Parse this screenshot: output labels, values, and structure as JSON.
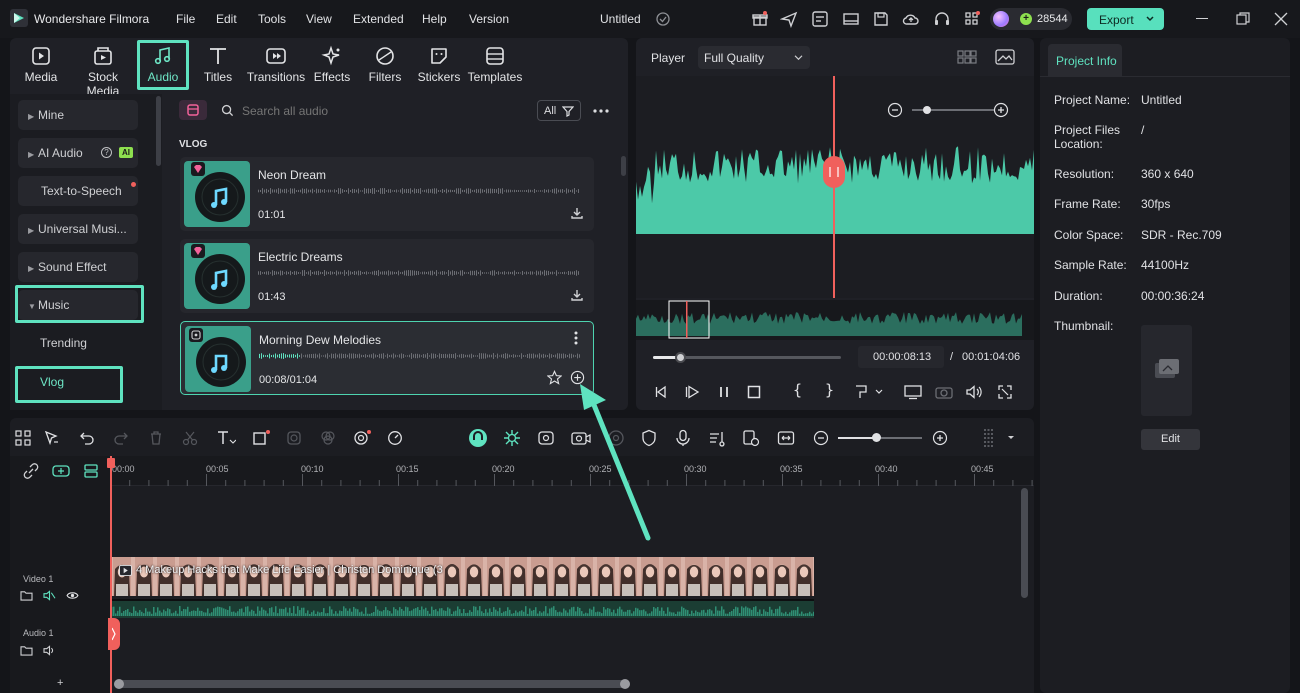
{
  "app": {
    "name": "Wondershare Filmora",
    "project_title": "Untitled",
    "credits": "28544",
    "export_label": "Export",
    "menu": [
      "File",
      "Edit",
      "Tools",
      "View",
      "Extended",
      "Help",
      "Version"
    ]
  },
  "tabs": [
    {
      "label": "Media",
      "icon": "media-icon"
    },
    {
      "label": "Stock Media",
      "icon": "stock-media-icon"
    },
    {
      "label": "Audio",
      "icon": "music-note-icon",
      "active": true
    },
    {
      "label": "Titles",
      "icon": "text-t-icon"
    },
    {
      "label": "Transitions",
      "icon": "transitions-icon"
    },
    {
      "label": "Effects",
      "icon": "effects-sparkle-icon"
    },
    {
      "label": "Filters",
      "icon": "filters-icon"
    },
    {
      "label": "Stickers",
      "icon": "sticker-icon"
    },
    {
      "label": "Templates",
      "icon": "templates-icon"
    }
  ],
  "sidebar": {
    "items": [
      {
        "label": "Mine"
      },
      {
        "label": "AI Audio",
        "badge": "AI"
      },
      {
        "label": "Text-to-Speech"
      },
      {
        "label": "Universal Musi..."
      },
      {
        "label": "Sound Effect"
      },
      {
        "label": "Music"
      },
      {
        "label": "Trending"
      },
      {
        "label": "Vlog"
      }
    ]
  },
  "audio_list": {
    "search_placeholder": "Search all audio",
    "filter_label": "All",
    "section": "VLOG",
    "items": [
      {
        "title": "Neon Dream",
        "duration": "01:01"
      },
      {
        "title": "Electric Dreams",
        "duration": "01:43"
      },
      {
        "title": "Morning Dew Melodies",
        "duration": "00:08/01:04"
      }
    ]
  },
  "player": {
    "label": "Player",
    "quality": "Full Quality",
    "current_time": "00:00:08:13",
    "separator": "/",
    "total_time": "00:01:04:06"
  },
  "project_info": {
    "tab": "Project Info",
    "name_label": "Project Name:",
    "name": "Untitled",
    "files_label_1": "Project Files",
    "files_label_2": "Location:",
    "files": "/",
    "resolution_label": "Resolution:",
    "resolution": "360 x 640",
    "frame_rate_label": "Frame Rate:",
    "frame_rate": "30fps",
    "color_space_label": "Color Space:",
    "color_space": "SDR - Rec.709",
    "sample_rate_label": "Sample Rate:",
    "sample_rate": "44100Hz",
    "duration_label": "Duration:",
    "duration": "00:00:36:24",
    "thumbnail_label": "Thumbnail:",
    "edit_label": "Edit"
  },
  "timeline": {
    "ticks": [
      "00:00",
      "00:05",
      "00:10",
      "00:15",
      "00:20",
      "00:25",
      "00:30",
      "00:35",
      "00:40",
      "00:45"
    ],
    "video_track": "Video 1",
    "audio_track": "Audio 1",
    "clip_title": "4 Makeup Hacks that Make Life Easier | Christen Dominique (3"
  },
  "colors": {
    "accent": "#5fe3c0",
    "waveform": "#4cc9a8",
    "playhead": "#f0605c",
    "export": "#58e0bd"
  }
}
